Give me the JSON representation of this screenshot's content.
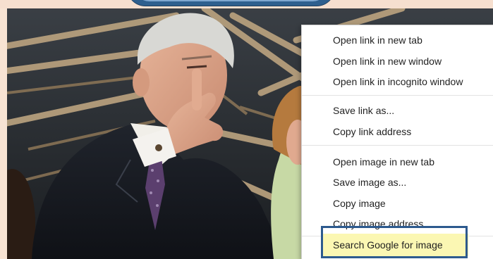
{
  "context_menu": {
    "items": [
      {
        "label": "Open link in new tab"
      },
      {
        "label": "Open link in new window"
      },
      {
        "label": "Open link in incognito window"
      },
      {
        "label": "Save link as..."
      },
      {
        "label": "Copy link address"
      },
      {
        "label": "Open image in new tab"
      },
      {
        "label": "Save image as..."
      },
      {
        "label": "Copy image"
      },
      {
        "label": "Copy image address"
      },
      {
        "label": "Search Google for image"
      }
    ]
  },
  "colors": {
    "highlight_fill": "#fbf7b3",
    "highlight_border": "#2d5a8e",
    "frame": "#f7e3d3"
  }
}
